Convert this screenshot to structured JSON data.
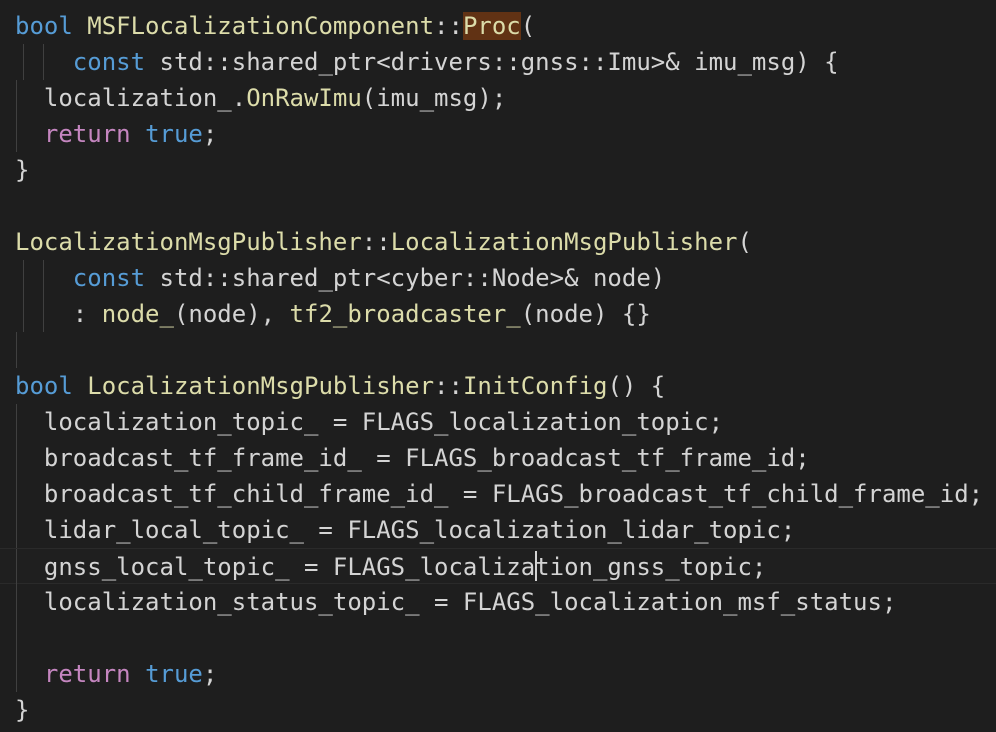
{
  "editor": {
    "theme": "dark",
    "colors": {
      "background": "#1e1e1e",
      "keyword": "#569cd6",
      "control_keyword": "#c586c0",
      "function": "#dcdcaa",
      "plain": "#d4d4d4",
      "match_highlight": "#613214"
    },
    "lines": [
      [
        [
          "kw",
          "bool"
        ],
        [
          "pl",
          " "
        ],
        [
          "fn",
          "MSFLocalizationComponent"
        ],
        [
          "pl",
          "::"
        ],
        [
          "fn",
          "Proc",
          "hl"
        ],
        [
          "pl",
          "("
        ]
      ],
      [
        [
          "pl",
          "    "
        ],
        [
          "kw",
          "const"
        ],
        [
          "pl",
          " std::shared_ptr<drivers::gnss::Imu>& imu_msg) {"
        ]
      ],
      [
        [
          "pl",
          "  localization_."
        ],
        [
          "fn",
          "OnRawImu"
        ],
        [
          "pl",
          "(imu_msg);"
        ]
      ],
      [
        [
          "pl",
          "  "
        ],
        [
          "ctrl",
          "return"
        ],
        [
          "pl",
          " "
        ],
        [
          "kw",
          "true"
        ],
        [
          "pl",
          ";"
        ]
      ],
      [
        [
          "pl",
          "}"
        ]
      ],
      [],
      [
        [
          "fn",
          "LocalizationMsgPublisher"
        ],
        [
          "pl",
          "::"
        ],
        [
          "fn",
          "LocalizationMsgPublisher"
        ],
        [
          "pl",
          "("
        ]
      ],
      [
        [
          "pl",
          "    "
        ],
        [
          "kw",
          "const"
        ],
        [
          "pl",
          " std::shared_ptr<cyber::Node>& node)"
        ]
      ],
      [
        [
          "pl",
          "    : "
        ],
        [
          "fn",
          "node_"
        ],
        [
          "pl",
          "(node), "
        ],
        [
          "fn",
          "tf2_broadcaster_"
        ],
        [
          "pl",
          "(node) {}"
        ]
      ],
      [],
      [
        [
          "kw",
          "bool"
        ],
        [
          "pl",
          " "
        ],
        [
          "fn",
          "LocalizationMsgPublisher"
        ],
        [
          "pl",
          "::"
        ],
        [
          "fn",
          "InitConfig"
        ],
        [
          "pl",
          "() {"
        ]
      ],
      [
        [
          "pl",
          "  localization_topic_ = FLAGS_localization_topic;"
        ]
      ],
      [
        [
          "pl",
          "  broadcast_tf_frame_id_ = FLAGS_broadcast_tf_frame_id;"
        ]
      ],
      [
        [
          "pl",
          "  broadcast_tf_child_frame_id_ = FLAGS_broadcast_tf_child_frame_id;"
        ]
      ],
      [
        [
          "pl",
          "  lidar_local_topic_ = FLAGS_localization_lidar_topic;"
        ]
      ],
      [
        [
          "pl",
          "  gnss_local_topic_ = FLAGS_localiza"
        ],
        [
          "cursor",
          ""
        ],
        [
          "pl",
          "tion_gnss_topic;"
        ]
      ],
      [
        [
          "pl",
          "  localization_status_topic_ = FLAGS_localization_msf_status;"
        ]
      ],
      [],
      [
        [
          "pl",
          "  "
        ],
        [
          "ctrl",
          "return"
        ],
        [
          "pl",
          " "
        ],
        [
          "kw",
          "true"
        ],
        [
          "pl",
          ";"
        ]
      ],
      [
        [
          "pl",
          "}"
        ]
      ]
    ],
    "cursor_line": 15
  }
}
